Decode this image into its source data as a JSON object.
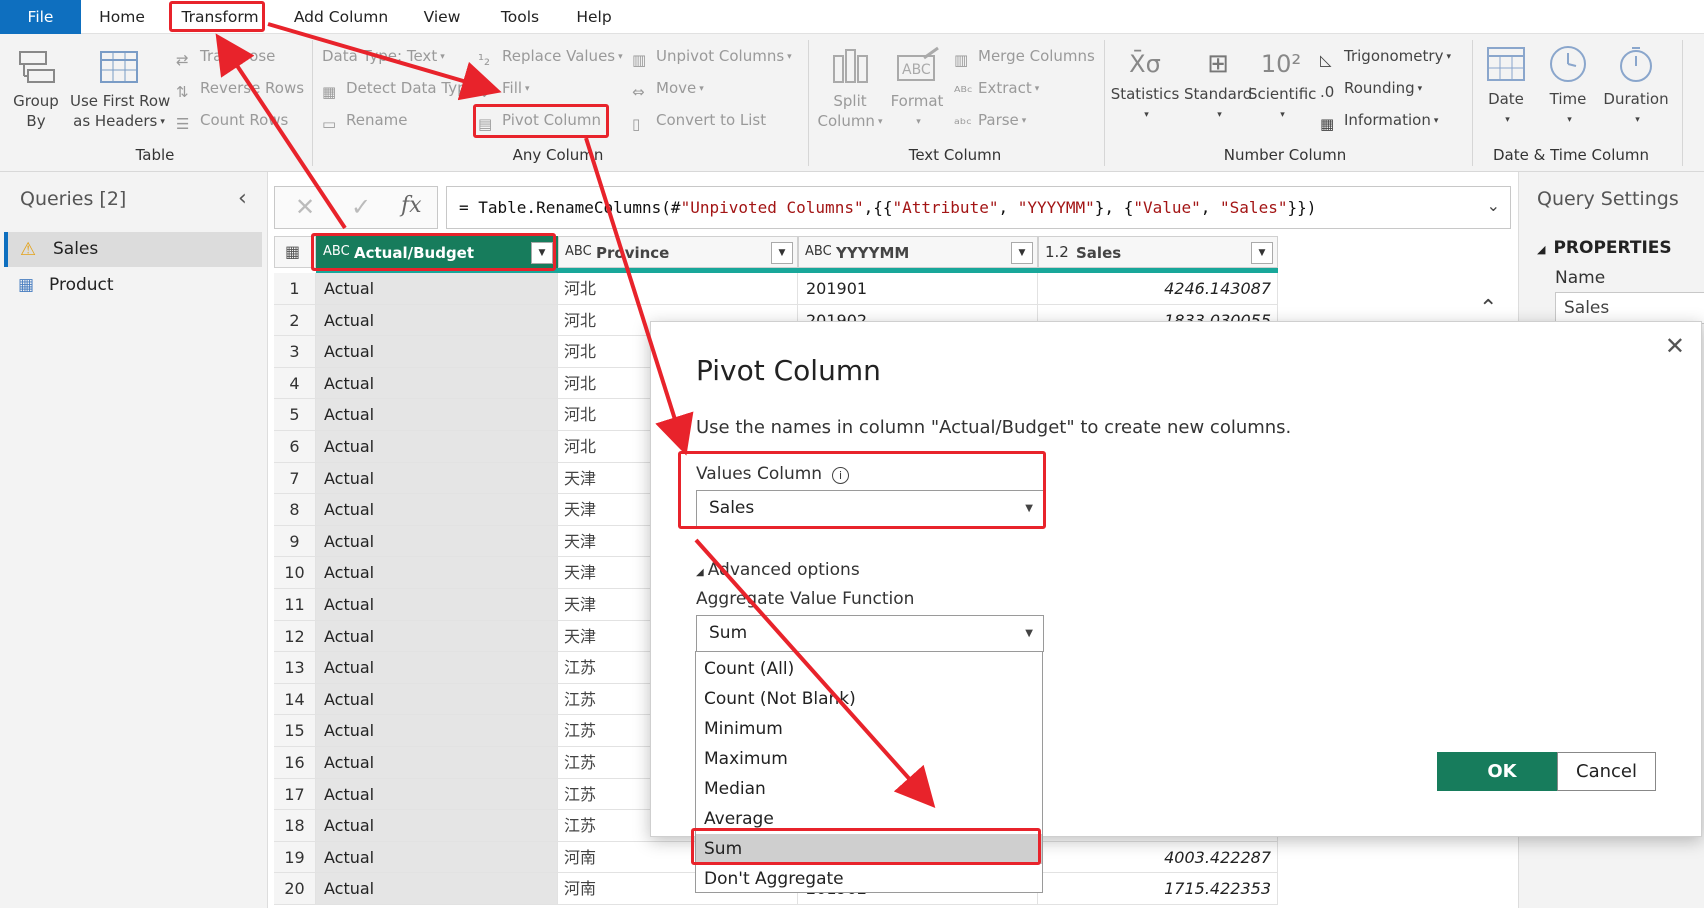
{
  "tabs": [
    "File",
    "Home",
    "Transform",
    "Add Column",
    "View",
    "Tools",
    "Help"
  ],
  "ribbon": {
    "table": {
      "group_by": [
        "Group",
        "By"
      ],
      "use_first_row": [
        "Use First Row",
        "as Headers"
      ],
      "transpose": "Transpose",
      "reverse_rows": "Reverse Rows",
      "count_rows": "Count Rows",
      "label": "Table"
    },
    "any_column": {
      "data_type": "Data Type: Text",
      "detect_data_type": "Detect Data Type",
      "rename": "Rename",
      "replace_values": "Replace Values",
      "fill": "Fill",
      "pivot_column": "Pivot Column",
      "unpivot_columns": "Unpivot Columns",
      "move": "Move",
      "convert_to_list": "Convert to List",
      "label": "Any Column"
    },
    "text_column": {
      "split_column": [
        "Split",
        "Column"
      ],
      "format": "Format",
      "merge_columns": "Merge Columns",
      "extract": "Extract",
      "parse": "Parse",
      "label": "Text Column"
    },
    "number_column": {
      "statistics": "Statistics",
      "standard": "Standard",
      "scientific": "Scientific",
      "trigonometry": "Trigonometry",
      "rounding": "Rounding",
      "information": "Information",
      "label": "Number Column"
    },
    "datetime_column": {
      "date": "Date",
      "time": "Time",
      "duration": "Duration",
      "label": "Date & Time Column"
    }
  },
  "queries": {
    "header": "Queries [2]",
    "items": [
      "Sales",
      "Product"
    ]
  },
  "formula": {
    "prefix": "= Table.RenameColumns(#",
    "s1": "\"Unpivoted Columns\"",
    "m1": ",{{",
    "s2": "\"Attribute\"",
    "m2": ", ",
    "s3": "\"YYYYMM\"",
    "m3": "}, {",
    "s4": "\"Value\"",
    "m4": ", ",
    "s5": "\"Sales\"",
    "suffix": "}})"
  },
  "columns": [
    {
      "type": "ABC",
      "name": "Actual/Budget"
    },
    {
      "type": "ABC",
      "name": "Province"
    },
    {
      "type": "ABC",
      "name": "YYYYMM"
    },
    {
      "type": "1.2",
      "name": "Sales"
    }
  ],
  "rows": [
    [
      "1",
      "Actual",
      "河北",
      "201901",
      "4246.143087"
    ],
    [
      "2",
      "Actual",
      "河北",
      "201902",
      "1833.030055"
    ],
    [
      "3",
      "Actual",
      "河北",
      "",
      ""
    ],
    [
      "4",
      "Actual",
      "河北",
      "",
      ""
    ],
    [
      "5",
      "Actual",
      "河北",
      "",
      ""
    ],
    [
      "6",
      "Actual",
      "河北",
      "",
      ""
    ],
    [
      "7",
      "Actual",
      "天津",
      "",
      ""
    ],
    [
      "8",
      "Actual",
      "天津",
      "",
      ""
    ],
    [
      "9",
      "Actual",
      "天津",
      "",
      ""
    ],
    [
      "10",
      "Actual",
      "天津",
      "",
      ""
    ],
    [
      "11",
      "Actual",
      "天津",
      "",
      ""
    ],
    [
      "12",
      "Actual",
      "天津",
      "",
      ""
    ],
    [
      "13",
      "Actual",
      "江苏",
      "",
      ""
    ],
    [
      "14",
      "Actual",
      "江苏",
      "",
      ""
    ],
    [
      "15",
      "Actual",
      "江苏",
      "",
      ""
    ],
    [
      "16",
      "Actual",
      "江苏",
      "",
      ""
    ],
    [
      "17",
      "Actual",
      "江苏",
      "",
      ""
    ],
    [
      "18",
      "Actual",
      "江苏",
      "",
      ""
    ],
    [
      "19",
      "Actual",
      "河南",
      "",
      "4003.422287"
    ],
    [
      "20",
      "Actual",
      "河南",
      "201902",
      "1715.422353"
    ]
  ],
  "query_settings": {
    "title": "Query Settings",
    "properties": "PROPERTIES",
    "name_label": "Name",
    "name_value": "Sales"
  },
  "dialog": {
    "title": "Pivot Column",
    "description": "Use the names in column \"Actual/Budget\" to create new columns.",
    "values_column_label": "Values Column",
    "values_column_value": "Sales",
    "advanced": "Advanced options",
    "agg_label": "Aggregate Value Function",
    "agg_value": "Sum",
    "options": [
      "Count (All)",
      "Count (Not Blank)",
      "Minimum",
      "Maximum",
      "Median",
      "Average",
      "Sum",
      "Don't Aggregate"
    ],
    "ok": "OK",
    "cancel": "Cancel"
  },
  "colors": {
    "accent": "#177c5c",
    "file_tab": "#0e6fbf",
    "annotation": "#e8232b"
  }
}
